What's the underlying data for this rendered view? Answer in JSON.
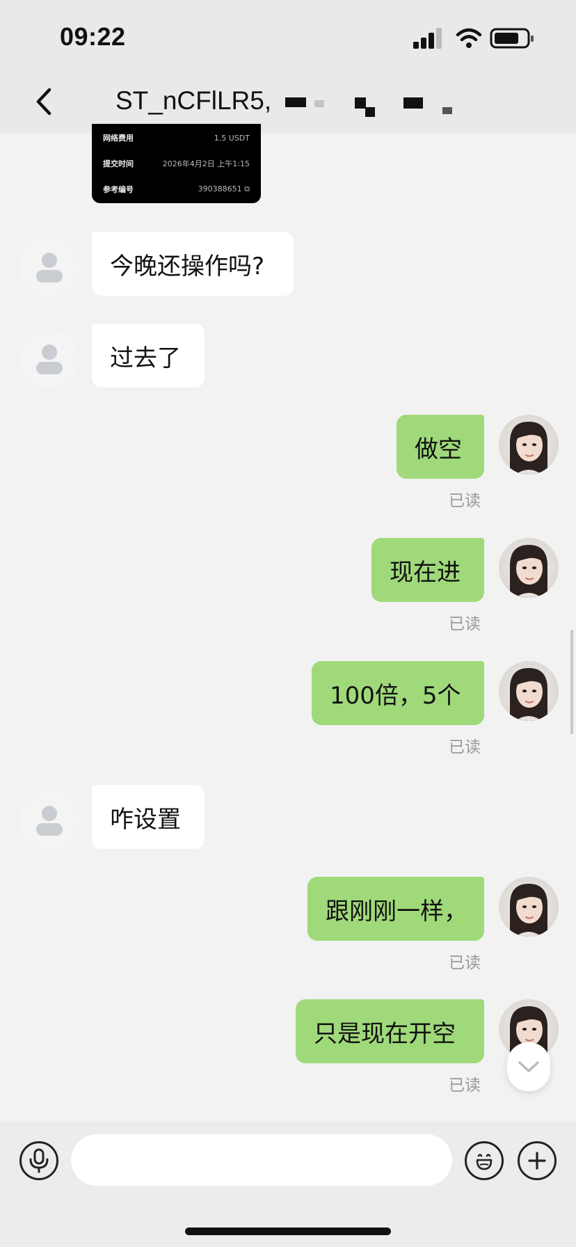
{
  "status": {
    "time": "09:22"
  },
  "header": {
    "title": "ST_nCFlLR5,"
  },
  "receipt": {
    "rows": [
      {
        "label": "网络费用",
        "value": "1.5 USDT"
      },
      {
        "label": "提交时间",
        "value": "2026年4月2日 上午1:15"
      },
      {
        "label": "参考编号",
        "value": "390388651 ⧉"
      }
    ]
  },
  "messages": [
    {
      "side": "in",
      "text": "今晚还操作吗?"
    },
    {
      "side": "in",
      "text": "过去了"
    },
    {
      "side": "out",
      "text": "做空",
      "read": "已读"
    },
    {
      "side": "out",
      "text": "现在进",
      "read": "已读"
    },
    {
      "side": "out",
      "text": "100倍，5个",
      "read": "已读"
    },
    {
      "side": "in",
      "text": "咋设置"
    },
    {
      "side": "out",
      "text": "跟刚刚一样，",
      "read": "已读"
    },
    {
      "side": "out",
      "text": "只是现在开空",
      "read": "已读"
    }
  ],
  "input": {
    "placeholder": ""
  },
  "colors": {
    "outgoing_bubble": "#9fd97a",
    "incoming_bubble": "#ffffff",
    "read_label": "#9a9a9a"
  },
  "icons": [
    "back-icon",
    "signal-icon",
    "wifi-icon",
    "battery-icon",
    "microphone-icon",
    "emoji-icon",
    "plus-icon",
    "chevron-down-icon"
  ]
}
